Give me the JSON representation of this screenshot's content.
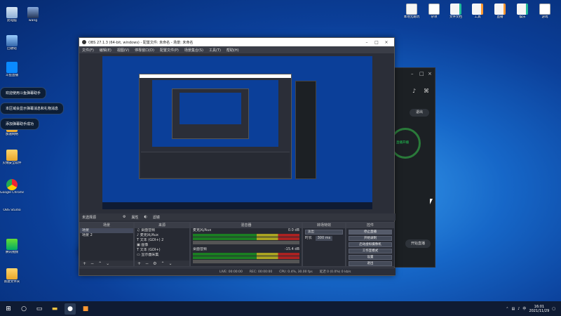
{
  "desktop_left": [
    {
      "label": "此电脑",
      "icon": "recycle"
    },
    {
      "label": "回收站",
      "icon": "net"
    },
    {
      "label": "斗鱼直播",
      "icon": "dy"
    },
    {
      "label": "加速网络",
      "icon": "folder"
    },
    {
      "label": "火绒安全软件",
      "icon": "folder"
    },
    {
      "label": "Google Chrome",
      "icon": "chrome"
    },
    {
      "label": "OBS Studio",
      "icon": "obs"
    },
    {
      "label": "腾讯视频",
      "icon": "player"
    },
    {
      "label": "新建文件夹",
      "icon": "folder"
    }
  ],
  "desktop_top_left": {
    "label": "wang",
    "icon": "user"
  },
  "desktop_top_right": [
    {
      "label": "本地无跳坑",
      "icon": "file"
    },
    {
      "label": "杂项",
      "icon": "doc"
    },
    {
      "label": "文件文档",
      "icon": "docg"
    },
    {
      "label": "工具",
      "icon": "docy"
    },
    {
      "label": "直播",
      "icon": "docy"
    },
    {
      "label": "娱乐",
      "icon": "docg"
    },
    {
      "label": "游戏",
      "icon": "doc"
    }
  ],
  "bubbles": [
    "欢迎使用斗鱼弹幕助手",
    "本区域会显示弹幕消息和礼物消息",
    "添加弹幕助手成功"
  ],
  "helper": {
    "logout": "退出",
    "start_live": "开始直播",
    "badge": "直播开播"
  },
  "obs": {
    "title": "OBS 27.1.3 (64-bit, windows) - 配置文件: 未命名 - 场景: 未命名",
    "menu": [
      "文件(F)",
      "编辑(E)",
      "视图(V)",
      "停靠窗口(D)",
      "配置文件(P)",
      "场景集合(S)",
      "工具(T)",
      "帮助(H)"
    ],
    "source_bar": {
      "no_source": "未选择源",
      "properties": "属性",
      "filters": "滤镜"
    },
    "docks": {
      "scenes": "场景",
      "sources": "来源",
      "mixer": "混音器",
      "transitions": "转场特效",
      "controls": "控件"
    },
    "scenes": [
      "场景",
      "场景 2"
    ],
    "sources": [
      "桌面音频",
      "麦克风/Aux",
      "文本 (GDI+) 2",
      "图像",
      "文本 (GDI+)",
      "显示器采集"
    ],
    "mixer": [
      {
        "name": "麦克风/Aux",
        "db": "0.0 dB"
      },
      {
        "name": "桌面音频",
        "db": "-15.4 dB"
      }
    ],
    "transition": {
      "type": "淡出",
      "duration_label": "时长",
      "duration": "300 ms"
    },
    "controls": [
      "停止直播",
      "开始录制",
      "启动虚拟摄像机",
      "工作室模式",
      "设置",
      "退出"
    ],
    "status": {
      "live": "LIVE: 00:00:00",
      "rec": "REC: 00:00:00",
      "cpu": "CPU: 0.4%, 30.00 fps",
      "net": "延迟 0 (0.0%) 0 kb/s"
    }
  },
  "taskbar": {
    "time": "16:01",
    "date": "2021/11/29"
  }
}
